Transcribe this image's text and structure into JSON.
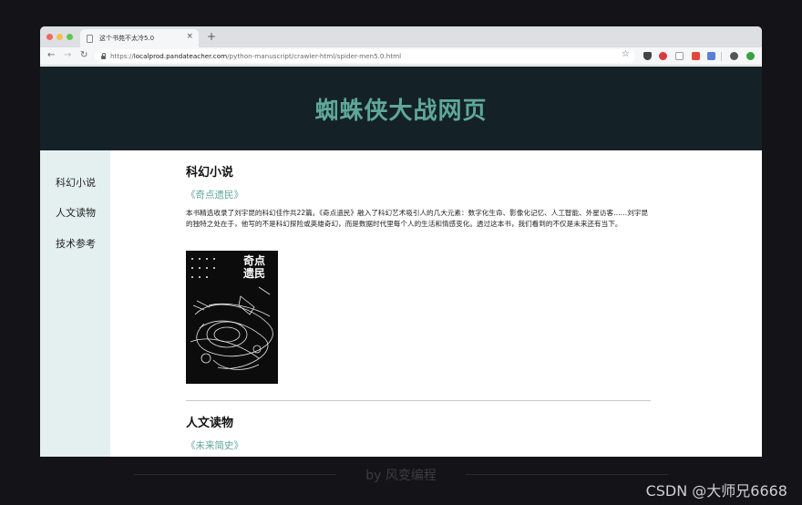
{
  "browser": {
    "tab_title": "这个书苑不太冷5.0",
    "tab_close": "×",
    "new_tab": "+",
    "nav_back": "←",
    "nav_forward": "→",
    "nav_reload": "↻",
    "url_scheme": "https://",
    "url_host": "localprod.pandateacher.com",
    "url_path": "/python-manuscript/crawler-html/spider-men5.0.html",
    "bookmark_star": "☆"
  },
  "page": {
    "header_title": "蜘蛛侠大战网页",
    "header_bg": "#142127",
    "accent_color": "#5fa79a",
    "sidebar_bg": "#e4f0ef",
    "sidebar": {
      "items": [
        {
          "label": "科幻小说"
        },
        {
          "label": "人文读物"
        },
        {
          "label": "技术参考"
        }
      ]
    },
    "sections": [
      {
        "title": "科幻小说",
        "book_link": "《奇点遗民》",
        "description": "本书精选收录了刘宇昆的科幻佳作共22篇。《奇点遗民》融入了科幻艺术吸引人的几大元素：数字化生命、影像化记忆、人工智能、外星访客……刘宇昆的独特之处在于，他写的不是科幻探险或英雄奇幻，而是数据时代里每个人的生活和情感变化。透过这本书，我们看到的不仅是未来还有当下。",
        "cover_title": "奇点遗民"
      },
      {
        "title": "人文读物",
        "book_link": "《未来简史》"
      }
    ]
  },
  "overlay": {
    "byline": "by 风变编程",
    "watermark": "CSDN @大师兄6668"
  }
}
